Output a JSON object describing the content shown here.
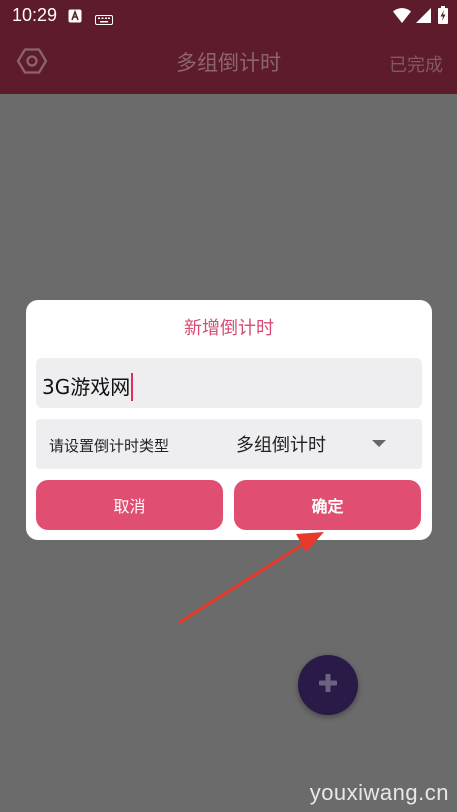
{
  "status_bar": {
    "time": "10:29",
    "icons": [
      "a-box-icon",
      "keyboard-icon",
      "wifi-icon",
      "signal-icon",
      "battery-charging-icon"
    ]
  },
  "app_bar": {
    "settings_icon": "hexagon-settings-icon",
    "title": "多组倒计时",
    "done_label": "已完成"
  },
  "dialog": {
    "title": "新增倒计时",
    "name_value": "3G游戏网",
    "type_label": "请设置倒计时类型",
    "type_selected": "多组倒计时",
    "cancel_label": "取消",
    "confirm_label": "确定"
  },
  "fab": {
    "icon": "plus-icon"
  },
  "watermark": "youxiwang.cn",
  "colors": {
    "app_bar": "#5e1b2c",
    "accent": "#e04e72",
    "dialog_title": "#d94b72",
    "arrow": "#e8392b",
    "fab": "#2a1a48"
  }
}
